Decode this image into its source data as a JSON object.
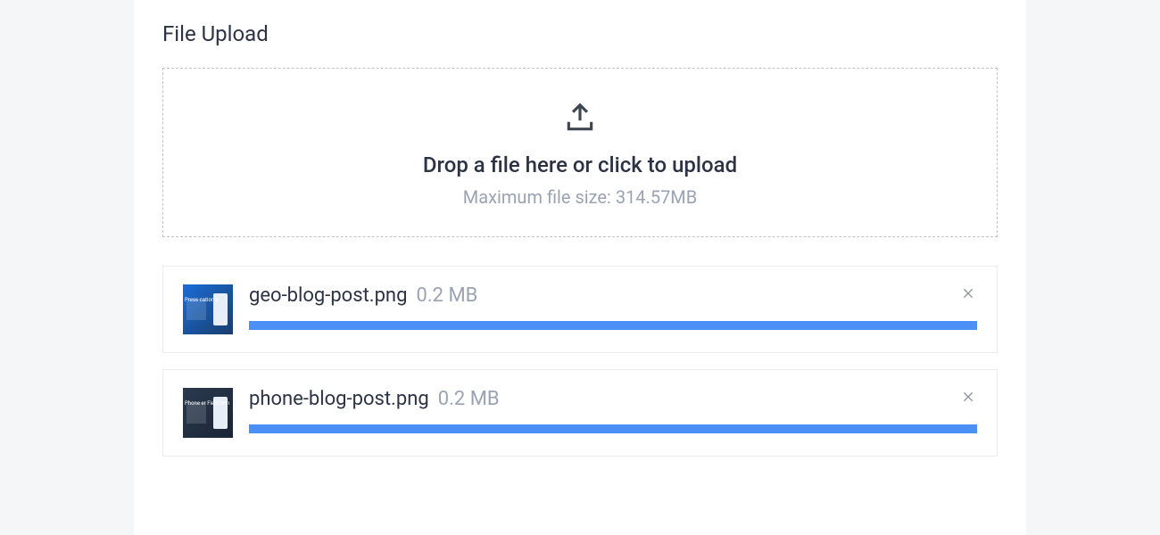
{
  "title": "File Upload",
  "dropzone": {
    "primary": "Drop a file here or click to upload",
    "secondary": "Maximum file size: 314.57MB"
  },
  "files": [
    {
      "name": "geo-blog-post.png",
      "size": "0.2 MB",
      "progress": 100,
      "thumbVariant": "blue",
      "thumbText": "Press\ncation\ns"
    },
    {
      "name": "phone-blog-post.png",
      "size": "0.2 MB",
      "progress": 100,
      "thumbVariant": "dark",
      "thumbText": "Phone\ner Field\norm"
    }
  ],
  "colors": {
    "accent": "#4a90f7",
    "text": "#2c3345",
    "muted": "#9aa3b2",
    "border": "#e9ebef"
  }
}
